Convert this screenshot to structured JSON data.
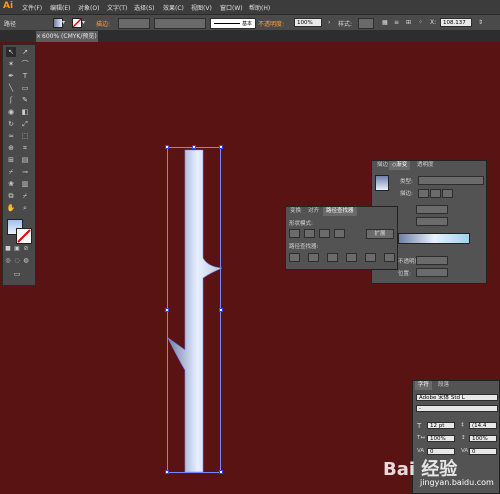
{
  "app": {
    "logo": "Ai"
  },
  "menubar": {
    "items": [
      "文件(F)",
      "编辑(E)",
      "对象(O)",
      "文字(T)",
      "选择(S)",
      "效果(C)",
      "视图(V)",
      "窗口(W)",
      "帮助(H)"
    ]
  },
  "controlbar": {
    "object_type": "路径",
    "stroke_label": "描边:",
    "stroke_profile": "基本",
    "opacity_label": "不透明度:",
    "opacity_value": "100%",
    "style_label": "样式:",
    "x_label": "X:",
    "x_value": "108.137",
    "colors": {
      "stroke_warning": "#ff9d3c"
    }
  },
  "document": {
    "tab_close": "×",
    "tab_title": "600% (CMYK/预览)"
  },
  "toolbox": {
    "tools": [
      "selection-tool",
      "direct-selection-tool",
      "magic-wand-tool",
      "lasso-tool",
      "pen-tool",
      "type-tool",
      "line-tool",
      "rectangle-tool",
      "paintbrush-tool",
      "pencil-tool",
      "blob-brush-tool",
      "eraser-tool",
      "rotate-tool",
      "scale-tool",
      "warp-tool",
      "free-transform-tool",
      "shape-builder-tool",
      "perspective-grid-tool",
      "mesh-tool",
      "gradient-tool",
      "eyedropper-tool",
      "blend-tool",
      "symbol-sprayer-tool",
      "column-graph-tool",
      "artboard-tool",
      "slice-tool",
      "hand-tool",
      "zoom-tool"
    ]
  },
  "canvas": {
    "background": "#5a1313",
    "artwork_gradient": [
      "#6f7fa8",
      "#e8f0ff"
    ]
  },
  "pathfinder_panel": {
    "tabs": [
      "变换",
      "对齐",
      "路径查找器"
    ],
    "shape_modes_label": "形状模式:",
    "expand_button": "扩展",
    "pathfinders_label": "路径查找器:"
  },
  "gradient_panel": {
    "tabs": [
      "描边",
      "◇渐变",
      "透明度"
    ],
    "type_label": "类型:",
    "stroke_label": "描边:",
    "opacity_label": "不透明度:",
    "location_label": "位置:"
  },
  "character_panel": {
    "tabs": [
      "字符",
      "段落"
    ],
    "font_family": "Adobe 宋体 Std L",
    "font_style": "-",
    "font_size": "12 pt",
    "leading": "(14.4",
    "horizontal_scale": "100%",
    "vertical_scale": "100%",
    "tracking_value": "0",
    "kerning_value": "0"
  },
  "watermark": {
    "main": "Bai 经验",
    "sub": "jingyan.baidu.com"
  }
}
